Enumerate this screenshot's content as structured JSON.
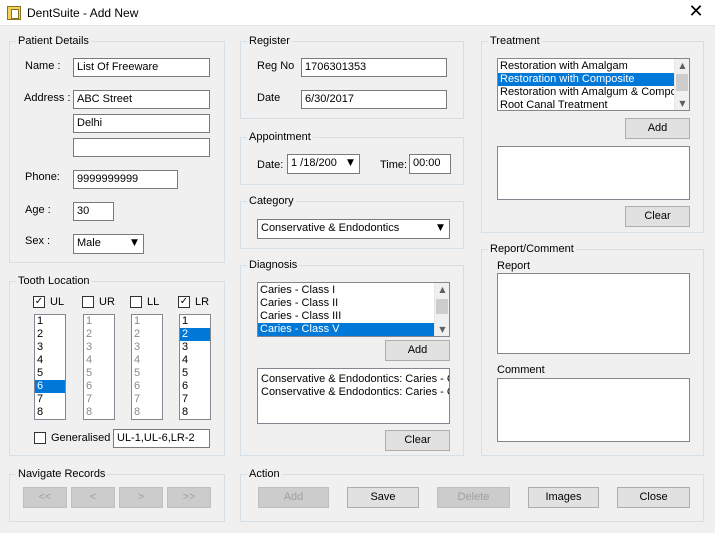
{
  "window": {
    "title": "DentSuite - Add New",
    "close_glyph": "✕"
  },
  "patient": {
    "legend": "Patient Details",
    "name_label": "Name :",
    "name_value": "List Of Freeware",
    "address_label": "Address :",
    "address_line1": "ABC Street",
    "address_line2": "Delhi",
    "address_line3": "",
    "phone_label": "Phone:",
    "phone_value": "9999999999",
    "age_label": "Age :",
    "age_value": "30",
    "sex_label": "Sex :",
    "sex_value": "Male"
  },
  "register": {
    "legend": "Register",
    "regno_label": "Reg No",
    "regno_value": "1706301353",
    "date_label": "Date",
    "date_value": "6/30/2017"
  },
  "appointment": {
    "legend": "Appointment",
    "date_label": "Date:",
    "date_value": "1 /18/200",
    "time_label": "Time:",
    "time_value": "00:00"
  },
  "category": {
    "legend": "Category",
    "value": "Conservative & Endodontics"
  },
  "diagnosis": {
    "legend": "Diagnosis",
    "items": [
      "Caries - Class I",
      "Caries - Class II",
      "Caries - Class III",
      "Caries - Class V"
    ],
    "selected_index": 3,
    "add_label": "Add",
    "entries": [
      "Conservative & Endodontics: Caries - Class V",
      "Conservative & Endodontics: Caries - Class III"
    ],
    "clear_label": "Clear"
  },
  "treatment": {
    "legend": "Treatment",
    "items": [
      "Restoration with Amalgam",
      "Restoration with Composite",
      "Restoration with Amalgum & Composite",
      "Root Canal Treatment"
    ],
    "selected_index": 1,
    "add_label": "Add",
    "clear_label": "Clear"
  },
  "report_comment": {
    "legend": "Report/Comment",
    "report_label": "Report",
    "comment_label": "Comment"
  },
  "tooth": {
    "legend": "Tooth Location",
    "quadrants": [
      {
        "label": "UL",
        "checked": true,
        "selected": 6
      },
      {
        "label": "UR",
        "checked": false,
        "selected": 0
      },
      {
        "label": "LL",
        "checked": false,
        "selected": 0
      },
      {
        "label": "LR",
        "checked": true,
        "selected": 2
      }
    ],
    "numbers": [
      "1",
      "2",
      "3",
      "4",
      "5",
      "6",
      "7",
      "8"
    ],
    "generalised_label": "Generalised",
    "summary": "UL-1,UL-6,LR-2"
  },
  "navigate": {
    "legend": "Navigate Records",
    "first": "<<",
    "prev": "<",
    "next": ">",
    "last": ">>"
  },
  "action": {
    "legend": "Action",
    "add": "Add",
    "save": "Save",
    "delete": "Delete",
    "images": "Images",
    "close": "Close"
  },
  "glyphs": {
    "check": "✓",
    "dropdown": "▼",
    "scroll_up": "▲",
    "scroll_down": "▼"
  }
}
